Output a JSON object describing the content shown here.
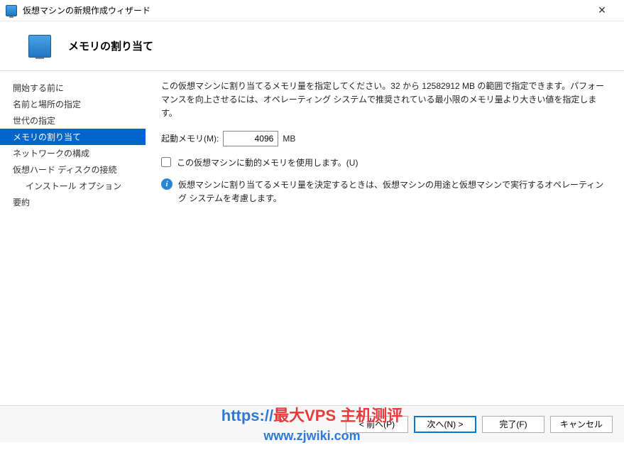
{
  "window": {
    "title": "仮想マシンの新規作成ウィザード",
    "close_symbol": "✕"
  },
  "header": {
    "title": "メモリの割り当て"
  },
  "sidebar": {
    "items": [
      {
        "label": "開始する前に"
      },
      {
        "label": "名前と場所の指定"
      },
      {
        "label": "世代の指定"
      },
      {
        "label": "メモリの割り当て",
        "selected": true
      },
      {
        "label": "ネットワークの構成"
      },
      {
        "label": "仮想ハード ディスクの接続"
      },
      {
        "label": "インストール オプション",
        "sub": true
      },
      {
        "label": "要約"
      }
    ]
  },
  "main": {
    "description": "この仮想マシンに割り当てるメモリ量を指定してください。32 から 12582912 MB の範囲で指定できます。パフォーマンスを向上させるには、オペレーティング システムで推奨されている最小限のメモリ量より大きい値を指定します。",
    "memory_label": "起動メモリ(M):",
    "memory_value": "4096",
    "memory_unit": "MB",
    "dynamic_memory_label": "この仮想マシンに動的メモリを使用します。(U)",
    "dynamic_memory_checked": false,
    "info_text": "仮想マシンに割り当てるメモリ量を決定するときは、仮想マシンの用途と仮想マシンで実行するオペレーティング システムを考慮します。"
  },
  "footer": {
    "back": "< 前へ(P)",
    "next": "次へ(N) >",
    "finish": "完了(F)",
    "cancel": "キャンセル"
  },
  "watermark": {
    "prefix": "https://",
    "a": "最大VPS 主机测评",
    "domain": "www.zjwiki.com"
  }
}
